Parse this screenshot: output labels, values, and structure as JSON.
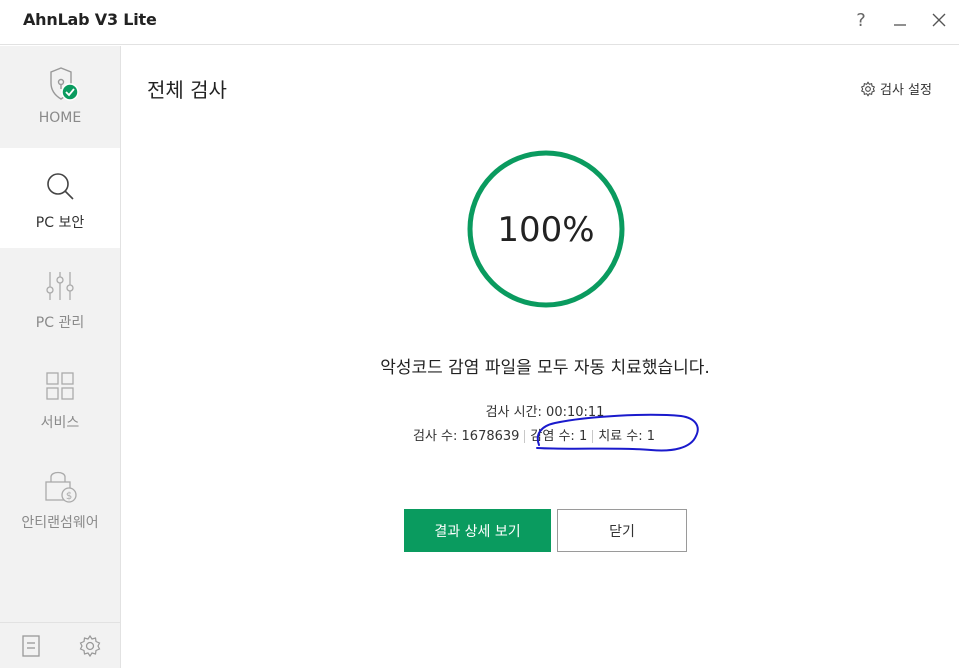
{
  "window": {
    "title": "AhnLab V3 Lite",
    "help": "?",
    "minimize": "—",
    "close": "✕"
  },
  "sidebar": {
    "items": [
      {
        "label": "HOME",
        "icon": "shield-check-icon"
      },
      {
        "label": "PC 보안",
        "icon": "search-icon"
      },
      {
        "label": "PC 관리",
        "icon": "sliders-icon"
      },
      {
        "label": "서비스",
        "icon": "grid-icon"
      },
      {
        "label": "안티랜섬웨어",
        "icon": "lock-dollar-icon"
      }
    ],
    "active_index": 1,
    "bottom": {
      "left_icon": "document-icon",
      "right_icon": "gear-icon"
    }
  },
  "main": {
    "title": "전체 검사",
    "settings_label": "검사 설정",
    "progress_text": "100%",
    "progress": 1.0,
    "message": "악성코드 감염 파일을 모두 자동 치료했습니다.",
    "scan_time": "검사 시간: 00:10:11",
    "scan_count": "검사 수: 1678639",
    "infected_count": "감염 수: 1",
    "cured_count": "치료 수: 1",
    "primary_button": "결과 상세 보기",
    "secondary_button": "닫기"
  },
  "colors": {
    "accent": "#0a9b5f",
    "annotation": "#1a1acc",
    "sidebar_bg": "#f2f2f2"
  }
}
